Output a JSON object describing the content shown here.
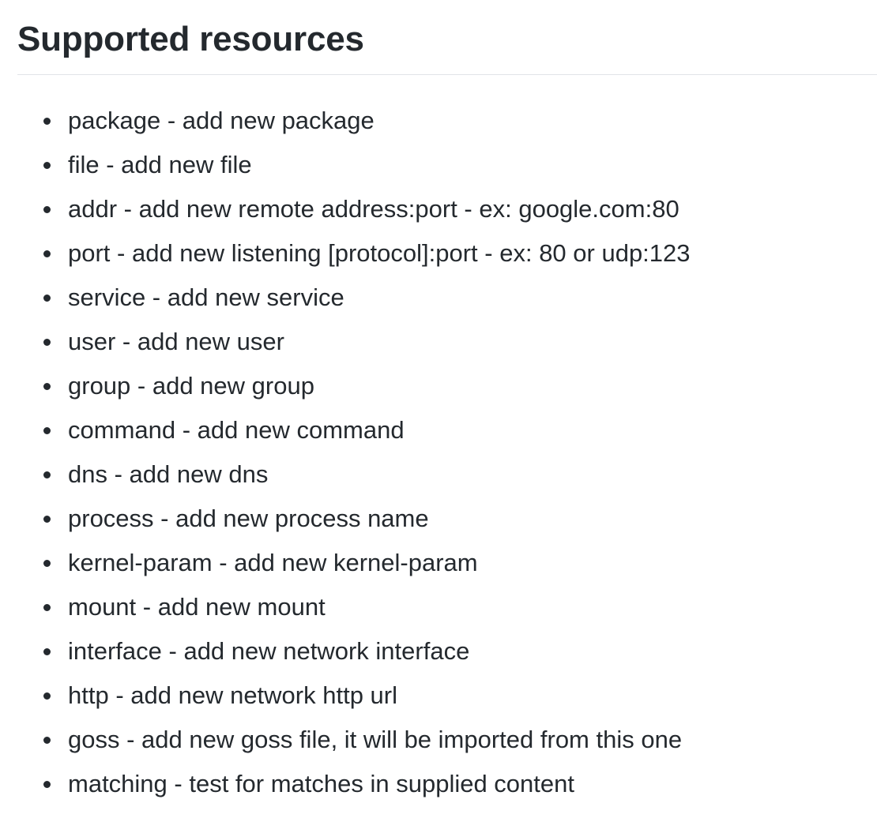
{
  "heading": "Supported resources",
  "items": [
    "package - add new package",
    "file - add new file",
    "addr - add new remote address:port - ex: google.com:80",
    "port - add new listening [protocol]:port - ex: 80 or udp:123",
    "service - add new service",
    "user - add new user",
    "group - add new group",
    "command - add new command",
    "dns - add new dns",
    "process - add new process name",
    "kernel-param - add new kernel-param",
    "mount - add new mount",
    "interface - add new network interface",
    "http - add new network http url",
    "goss - add new goss file, it will be imported from this one",
    "matching - test for matches in supplied content"
  ]
}
